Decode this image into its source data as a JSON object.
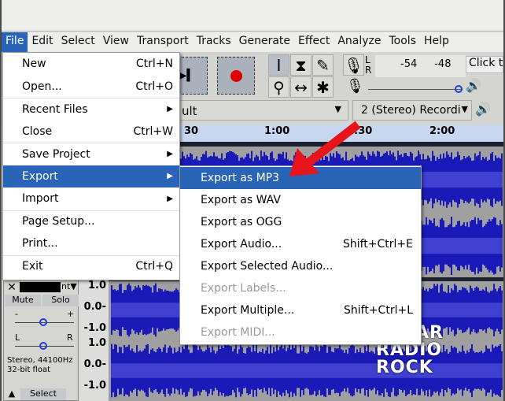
{
  "menubar": [
    "File",
    "Edit",
    "Select",
    "View",
    "Transport",
    "Tracks",
    "Generate",
    "Effect",
    "Analyze",
    "Tools",
    "Help"
  ],
  "file_menu": [
    {
      "label": "New",
      "accel": "Ctrl+N"
    },
    {
      "label": "Open...",
      "accel": "Ctrl+O"
    },
    {
      "label": "Recent Files",
      "submenu": true
    },
    {
      "label": "Close",
      "accel": "Ctrl+W"
    },
    {
      "label": "Save Project",
      "submenu": true
    },
    {
      "label": "Export",
      "submenu": true,
      "selected": true
    },
    {
      "label": "Import",
      "submenu": true
    },
    {
      "label": "Page Setup..."
    },
    {
      "label": "Print..."
    },
    {
      "label": "Exit",
      "accel": "Ctrl+Q"
    }
  ],
  "export_menu": [
    {
      "label": "Export as MP3",
      "selected": true
    },
    {
      "label": "Export as WAV"
    },
    {
      "label": "Export as OGG"
    },
    {
      "label": "Export Audio...",
      "accel": "Shift+Ctrl+E"
    },
    {
      "label": "Export Selected Audio..."
    },
    {
      "label": "Export Labels...",
      "disabled": true
    },
    {
      "label": "Export Multiple...",
      "accel": "Shift+Ctrl+L"
    },
    {
      "label": "Export MIDI...",
      "disabled": true
    }
  ],
  "meter": {
    "l": "L",
    "r": "R",
    "ticks": [
      "-54",
      "-48",
      "-"
    ],
    "click_text": "Click to"
  },
  "device": {
    "host": "ult",
    "channels": "2 (Stereo) Recordi"
  },
  "ruler": {
    "ticks": [
      "30",
      "1:00",
      "1:30",
      "2:00"
    ]
  },
  "track": {
    "name": "nt",
    "mute": "Mute",
    "solo": "Solo",
    "gain_minus": "-",
    "gain_plus": "+",
    "pan_l": "L",
    "pan_r": "R",
    "info1": "Stereo, 44100Hz",
    "info2": "32-bit float",
    "select": "Select"
  },
  "vruler": [
    "1.0",
    "0.0-",
    "-1.0"
  ],
  "watermark": "cesar radio rock",
  "colors": {
    "accent": "#2a64b6",
    "wave": "#1a1ab8",
    "arrow": "#e8141c"
  }
}
